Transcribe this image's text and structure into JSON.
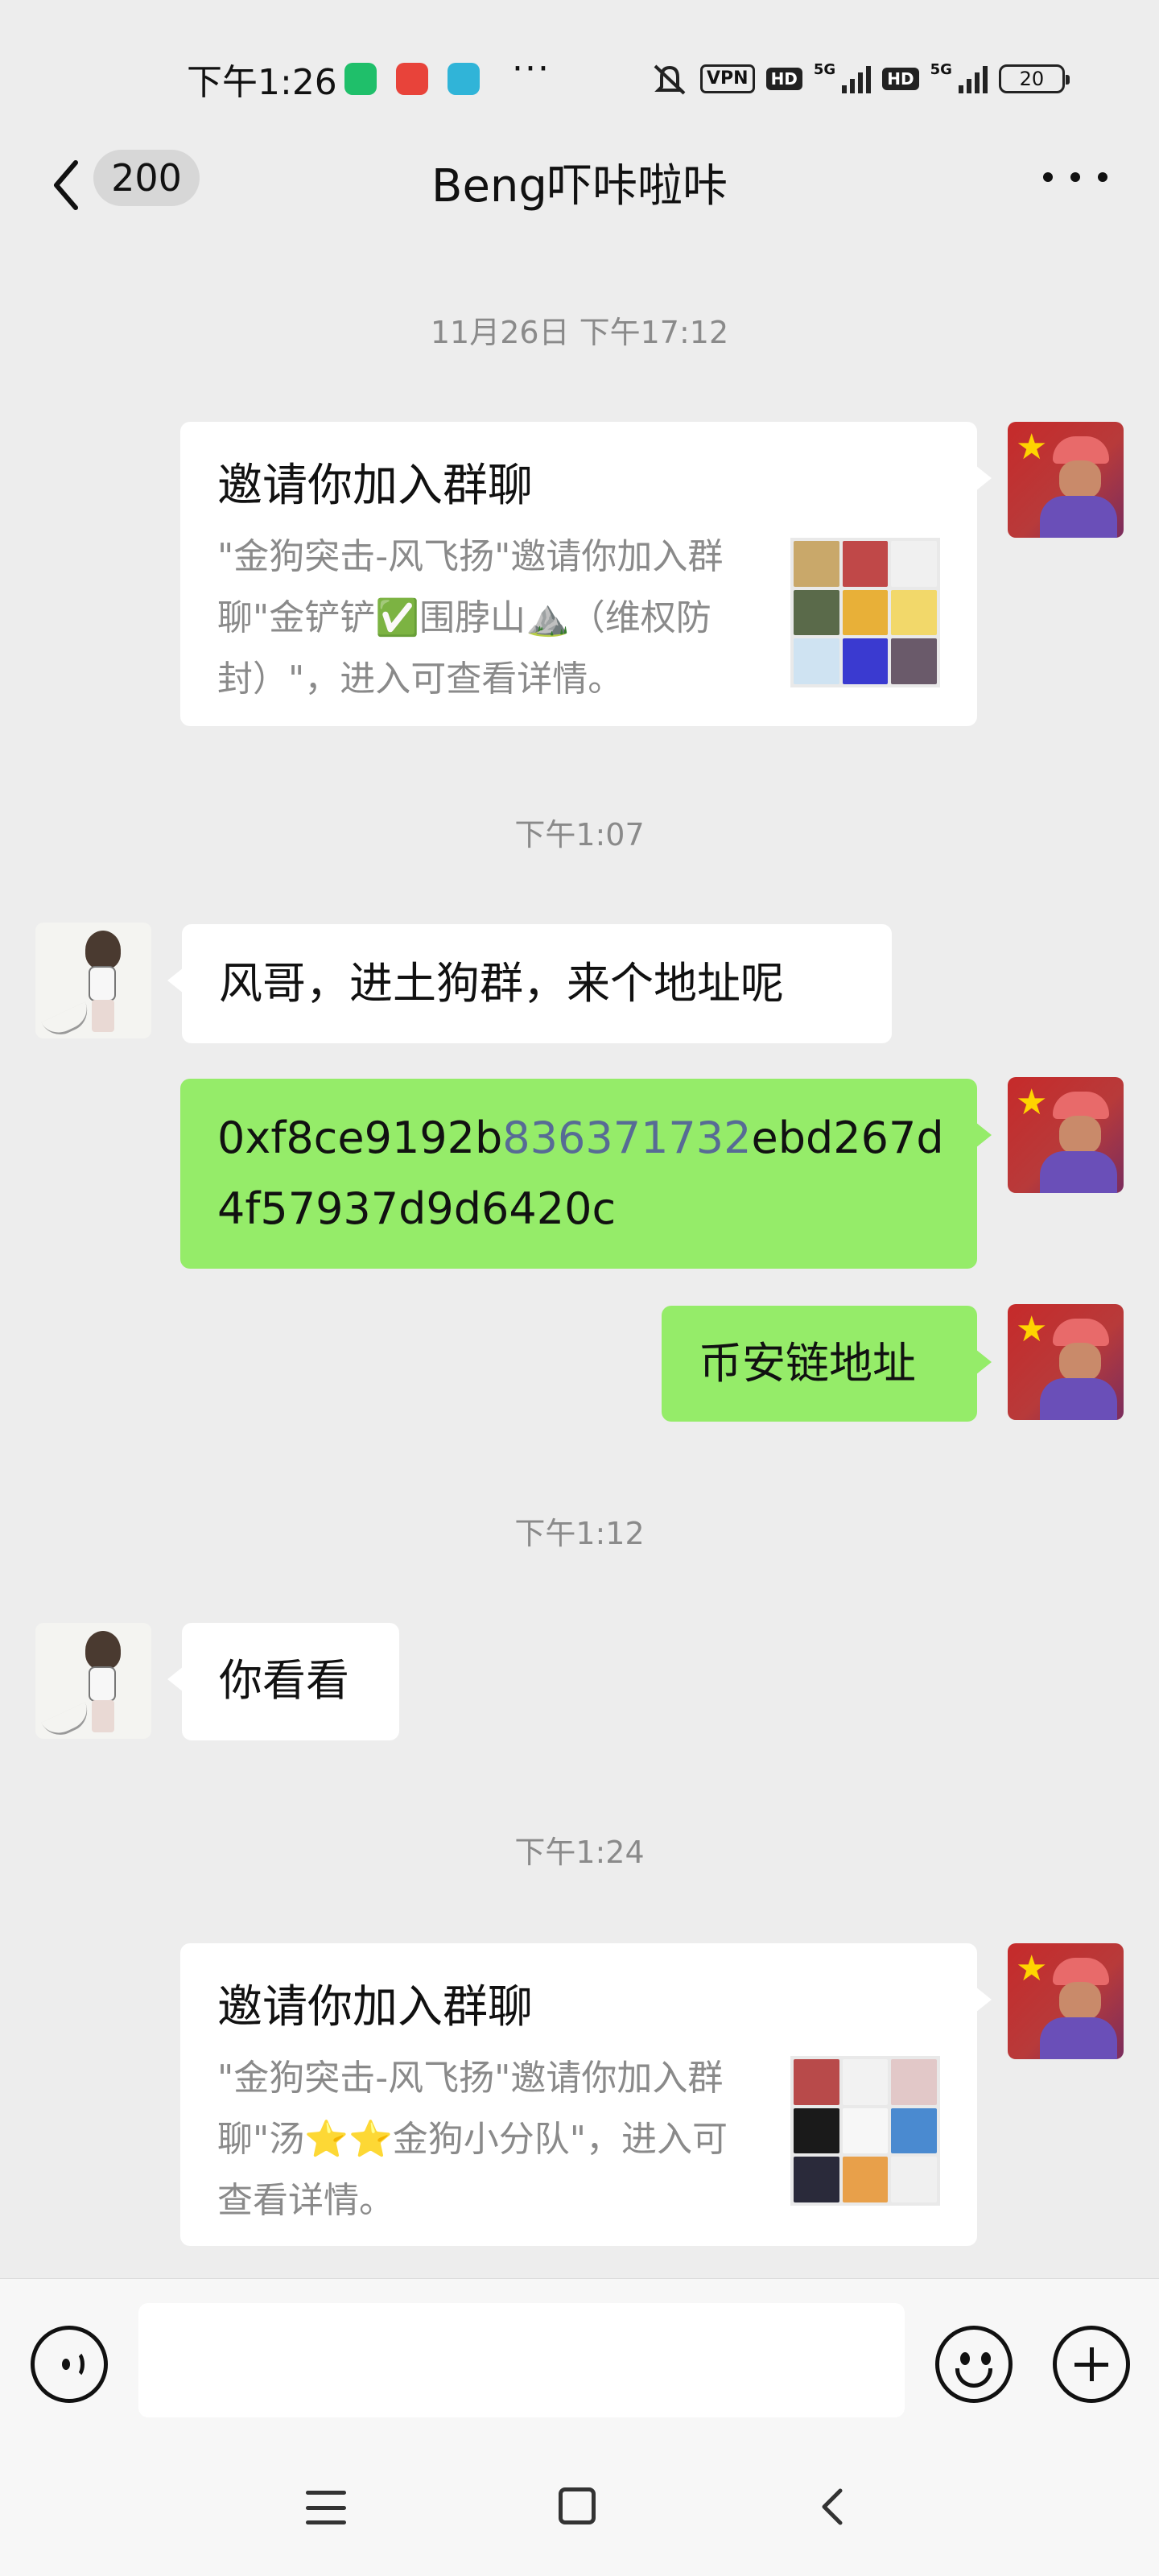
{
  "status_bar": {
    "time": "下午1:26",
    "more": "···",
    "vpn": "VPN",
    "hd": "HD",
    "network": "5G",
    "battery": "20"
  },
  "header": {
    "unread_count": "200",
    "title": "Beng吓咔啦咔"
  },
  "messages": {
    "ts1": "11月26日 下午17:12",
    "invite1": {
      "title": "邀请你加入群聊",
      "desc": "\"金狗突击-风飞扬\"邀请你加入群聊\"金铲铲✅围脖山⛰️（维权防封）\"，进入可查看详情。"
    },
    "ts2": "下午1:07",
    "msg_her_1": "风哥，进土狗群，来个地址呢",
    "address": {
      "part1": "0xf8ce9192b",
      "part2": "836371732",
      "part3": "ebd267d4f57937d9d6420c"
    },
    "msg_me_chain": "币安链地址",
    "ts3": "下午1:12",
    "msg_her_2": "你看看",
    "ts4": "下午1:24",
    "invite2": {
      "title": "邀请你加入群聊",
      "desc": "\"金狗突击-风飞扬\"邀请你加入群聊\"汤⭐⭐金狗小分队\"，进入可查看详情。"
    }
  },
  "colors": {
    "background": "#ededed",
    "bubble_green": "#95ec69",
    "link": "#576b95"
  }
}
